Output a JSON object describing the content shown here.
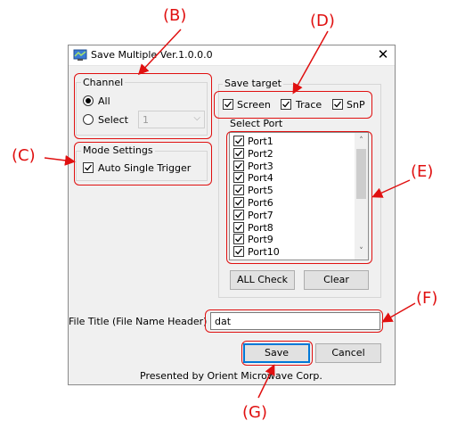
{
  "window": {
    "title": "Save Multiple Ver.1.0.0.0",
    "close_glyph": "✕"
  },
  "channel": {
    "label": "Channel",
    "option_all": "All",
    "option_select": "Select",
    "select_value": "1",
    "selected": "All"
  },
  "mode": {
    "label": "Mode Settings",
    "auto_single_trigger": "Auto Single Trigger",
    "auto_single_trigger_checked": true
  },
  "save_target": {
    "label": "Save target",
    "options": [
      {
        "label": "Screen",
        "checked": true
      },
      {
        "label": "Trace",
        "checked": true
      },
      {
        "label": "SnP",
        "checked": true
      }
    ]
  },
  "select_port": {
    "label": "Select Port",
    "ports": [
      "Port1",
      "Port2",
      "Port3",
      "Port4",
      "Port5",
      "Port6",
      "Port7",
      "Port8",
      "Port9",
      "Port10"
    ],
    "all_check": "ALL Check",
    "clear": "Clear"
  },
  "file_title": {
    "label": "File Title (File Name Header)",
    "value": "dat"
  },
  "buttons": {
    "save": "Save",
    "cancel": "Cancel"
  },
  "footer": "Presented by Orient Microwave Corp.",
  "annotations": {
    "B": "(B)",
    "C": "(C)",
    "D": "(D)",
    "E": "(E)",
    "F": "(F)",
    "G": "(G)"
  },
  "colors": {
    "annotation": "#e01010",
    "accent": "#0078d7"
  }
}
